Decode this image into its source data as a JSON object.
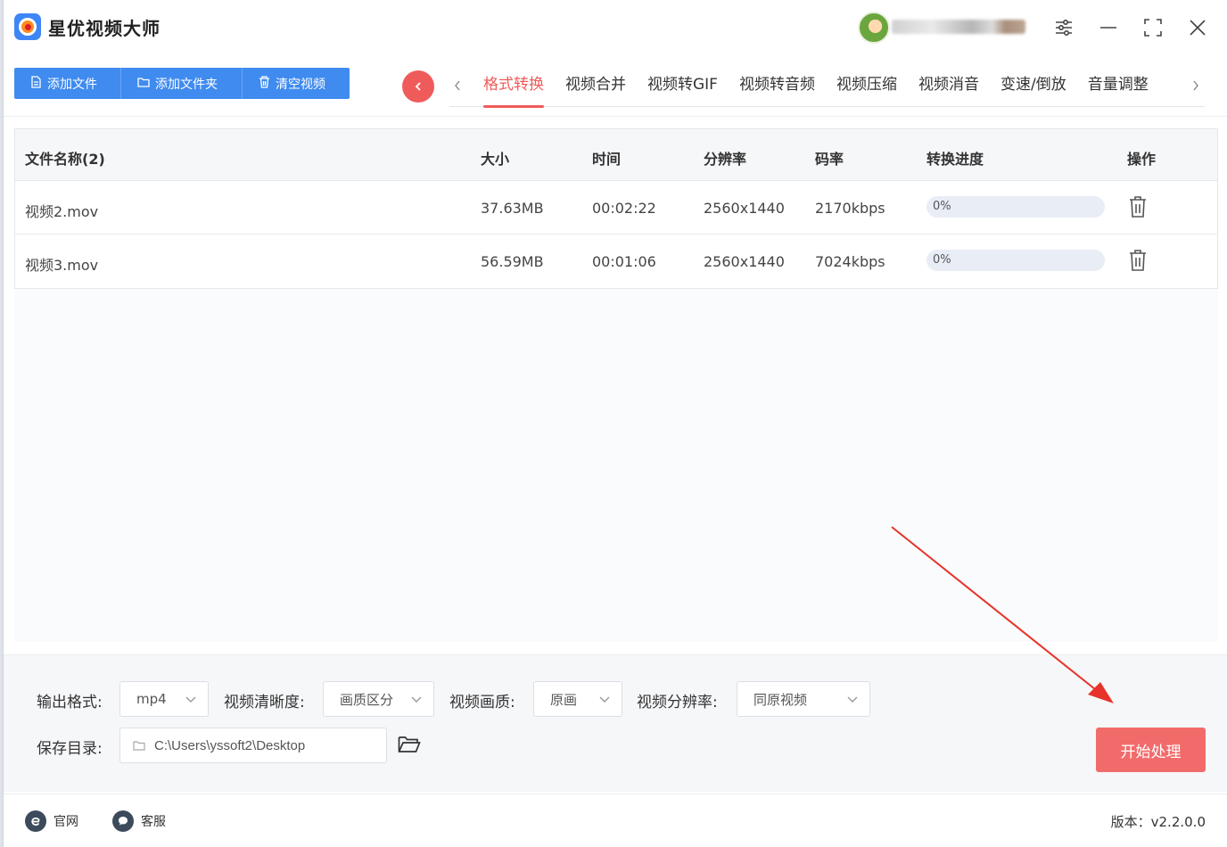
{
  "app": {
    "title": "星优视频大师"
  },
  "toolbar": {
    "add_file": "添加文件",
    "add_folder": "添加文件夹",
    "clear_videos": "清空视频"
  },
  "tabs": [
    {
      "label": "格式转换",
      "active": true
    },
    {
      "label": "视频合并"
    },
    {
      "label": "视频转GIF"
    },
    {
      "label": "视频转音频"
    },
    {
      "label": "视频压缩"
    },
    {
      "label": "视频消音"
    },
    {
      "label": "变速/倒放"
    },
    {
      "label": "音量调整"
    }
  ],
  "table": {
    "headers": [
      "文件名称(2)",
      "大小",
      "时间",
      "分辨率",
      "码率",
      "转换进度",
      "操作"
    ],
    "rows": [
      {
        "name": "视频2.mov",
        "size": "37.63MB",
        "time": "00:02:22",
        "resolution": "2560x1440",
        "bitrate": "2170kbps",
        "progress_label": "0%",
        "progress": 0
      },
      {
        "name": "视频3.mov",
        "size": "56.59MB",
        "time": "00:01:06",
        "resolution": "2560x1440",
        "bitrate": "7024kbps",
        "progress_label": "0%",
        "progress": 0
      }
    ]
  },
  "settings": {
    "output_format_label": "输出格式:",
    "output_format_value": "mp4",
    "clarity_label": "视频清晰度:",
    "clarity_value": "画质区分",
    "quality_label": "视频画质:",
    "quality_value": "原画",
    "resolution_label": "视频分辨率:",
    "resolution_value": "同原视频",
    "save_dir_label": "保存目录:",
    "save_dir_value": "C:\\Users\\yssoft2\\Desktop",
    "start_button": "开始处理"
  },
  "footer": {
    "website": "官网",
    "support": "客服",
    "version": "版本：v2.2.0.0"
  },
  "colors": {
    "accent_blue": "#3f8bf0",
    "accent_red": "#ef5b5b",
    "start_button": "#f26b6b"
  }
}
